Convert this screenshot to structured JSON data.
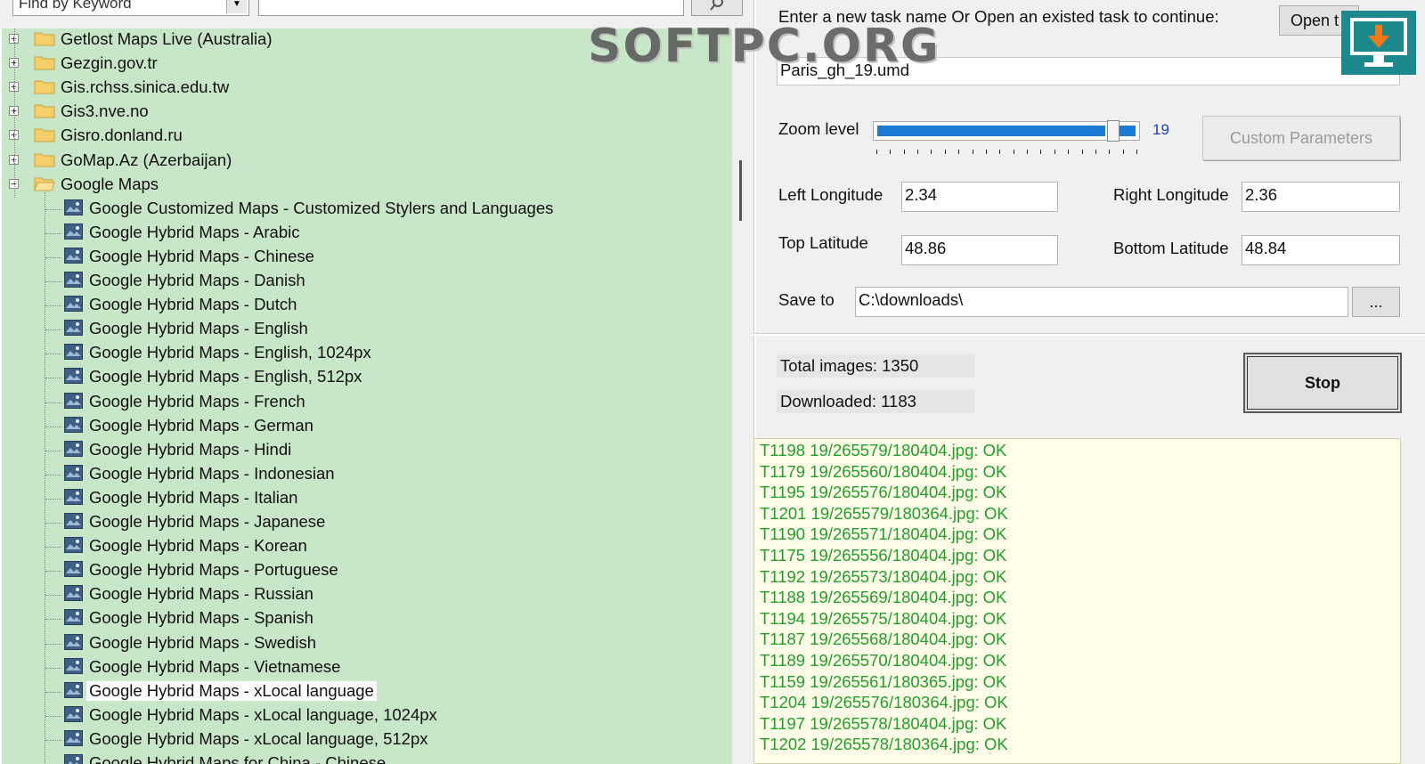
{
  "search": {
    "keyword_placeholder": "Find by Keyword",
    "input_value": ""
  },
  "tree": {
    "folders": [
      {
        "label": "Getlost Maps Live (Australia)",
        "expanded": false
      },
      {
        "label": "Gezgin.gov.tr",
        "expanded": false
      },
      {
        "label": "Gis.rchss.sinica.edu.tw",
        "expanded": false
      },
      {
        "label": "Gis3.nve.no",
        "expanded": false
      },
      {
        "label": "Gisro.donland.ru",
        "expanded": false
      },
      {
        "label": "GoMap.Az (Azerbaijan)",
        "expanded": false
      },
      {
        "label": "Google Maps",
        "expanded": true
      }
    ],
    "google_maps_children": [
      "Google Customized Maps - Customized Stylers and Languages",
      "Google Hybrid Maps - Arabic",
      "Google Hybrid Maps - Chinese",
      "Google Hybrid Maps - Danish",
      "Google Hybrid Maps - Dutch",
      "Google Hybrid Maps - English",
      "Google Hybrid Maps - English, 1024px",
      "Google Hybrid Maps - English, 512px",
      "Google Hybrid Maps - French",
      "Google Hybrid Maps - German",
      "Google Hybrid Maps - Hindi",
      "Google Hybrid Maps - Indonesian",
      "Google Hybrid Maps - Italian",
      "Google Hybrid Maps - Japanese",
      "Google Hybrid Maps - Korean",
      "Google Hybrid Maps - Portuguese",
      "Google Hybrid Maps - Russian",
      "Google Hybrid Maps - Spanish",
      "Google Hybrid Maps - Swedish",
      "Google Hybrid Maps - Vietnamese",
      "Google Hybrid Maps - xLocal language",
      "Google Hybrid Maps - xLocal language, 1024px",
      "Google Hybrid Maps - xLocal language, 512px",
      "Google Hybrid Maps for China - Chinese"
    ],
    "selected": "Google Hybrid Maps - xLocal language"
  },
  "task": {
    "prompt": "Enter a new task name Or Open an existed task to continue:",
    "open_button": "Open t",
    "name_value": "Paris_gh_19.umd"
  },
  "zoom": {
    "label": "Zoom level",
    "value": "19",
    "min": 0,
    "max": 19,
    "level": 19
  },
  "custom_params_button": "Custom Parameters",
  "coords": {
    "left_longitude_label": "Left Longitude",
    "left_longitude": "2.34",
    "right_longitude_label": "Right Longitude",
    "right_longitude": "2.36",
    "top_latitude_label": "Top Latitude",
    "top_latitude": "48.86",
    "bottom_latitude_label": "Bottom Latitude",
    "bottom_latitude": "48.84"
  },
  "save": {
    "label": "Save to",
    "path": "C:\\downloads\\",
    "browse": "..."
  },
  "stats": {
    "total": "Total images: 1350",
    "downloaded": "Downloaded: 1183"
  },
  "stop_button": "Stop",
  "log": [
    "T1198 19/265579/180404.jpg: OK",
    "T1179 19/265560/180404.jpg: OK",
    "T1195 19/265576/180404.jpg: OK",
    "T1201 19/265579/180364.jpg: OK",
    "T1190 19/265571/180404.jpg: OK",
    "T1175 19/265556/180404.jpg: OK",
    "T1192 19/265573/180404.jpg: OK",
    "T1188 19/265569/180404.jpg: OK",
    "T1194 19/265575/180404.jpg: OK",
    "T1187 19/265568/180404.jpg: OK",
    "T1189 19/265570/180404.jpg: OK",
    "T1159 19/265561/180365.jpg: OK",
    "T1204 19/265576/180364.jpg: OK",
    "T1197 19/265578/180404.jpg: OK",
    "T1202 19/265578/180364.jpg: OK"
  ],
  "watermark": "SOFTPC.ORG",
  "colors": {
    "tree_bg": "#c8e6c8",
    "log_text": "#22a02a",
    "log_bg": "#fdfde8",
    "slider_fill": "#1a7ad4",
    "logo": "#1c8a8c",
    "logo_arrow": "#f07a1a"
  }
}
